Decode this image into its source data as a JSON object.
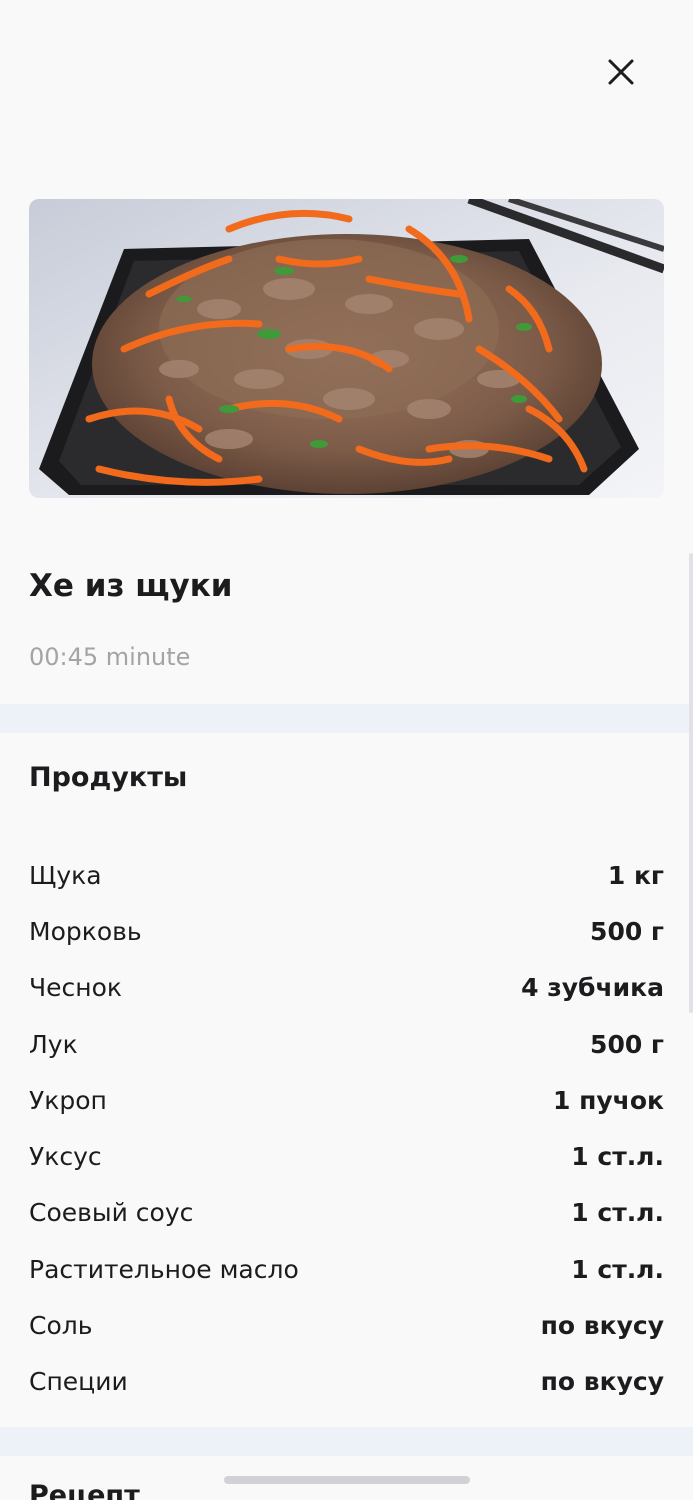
{
  "header": {
    "close_icon": "close-icon"
  },
  "recipe": {
    "title": "Хе из щуки",
    "duration": "00:45 minute"
  },
  "products": {
    "heading": "Продукты",
    "items": [
      {
        "name": "Щука",
        "qty": "1 кг"
      },
      {
        "name": "Морковь",
        "qty": "500 г"
      },
      {
        "name": "Чеснок",
        "qty": "4 зубчика"
      },
      {
        "name": "Лук",
        "qty": "500 г"
      },
      {
        "name": "Укроп",
        "qty": "1 пучок"
      },
      {
        "name": "Уксус",
        "qty": "1 ст.л."
      },
      {
        "name": "Соевый соус",
        "qty": "1 ст.л."
      },
      {
        "name": "Растительное масло",
        "qty": "1 ст.л."
      },
      {
        "name": "Соль",
        "qty": "по вкусу"
      },
      {
        "name": "Специи",
        "qty": "по вкусу"
      }
    ]
  },
  "recipe_section": {
    "heading": "Рецепт"
  },
  "colors": {
    "background": "#f9f9fa",
    "divider": "#edf1f8",
    "text_primary": "#1c1c1e",
    "text_secondary": "#a3a3a8",
    "carrot": "#f26a1b",
    "meat": "#8c6a55",
    "bowl": "#1b1b1d"
  }
}
